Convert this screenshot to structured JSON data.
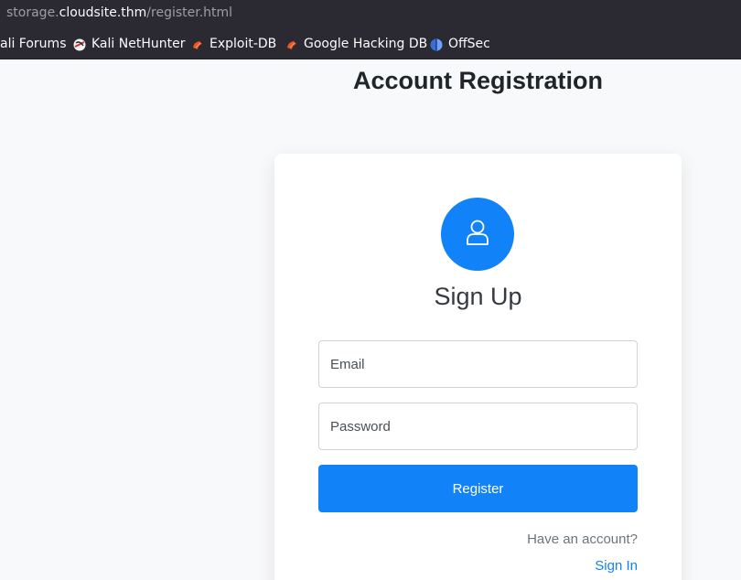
{
  "browser": {
    "url_prefix": "storage.",
    "url_domain": "cloudsite.thm",
    "url_path": "/register.html"
  },
  "bookmarks": [
    {
      "label": "ali Forums",
      "icon": "kali-forums-icon"
    },
    {
      "label": "Kali NetHunter",
      "icon": "kali-nethunter-icon"
    },
    {
      "label": "Exploit-DB",
      "icon": "exploit-db-icon"
    },
    {
      "label": "Google Hacking DB",
      "icon": "ghdb-icon"
    },
    {
      "label": "OffSec",
      "icon": "offsec-icon"
    }
  ],
  "page": {
    "title": "Account Registration"
  },
  "form": {
    "heading": "Sign Up",
    "email_placeholder": "Email",
    "password_placeholder": "Password",
    "register_label": "Register",
    "have_account": "Have an account?",
    "signin_label": "Sign In"
  },
  "colors": {
    "accent": "#1282f8",
    "browser_bar": "#2b2a33",
    "page_bg": "#f8f9fa"
  }
}
